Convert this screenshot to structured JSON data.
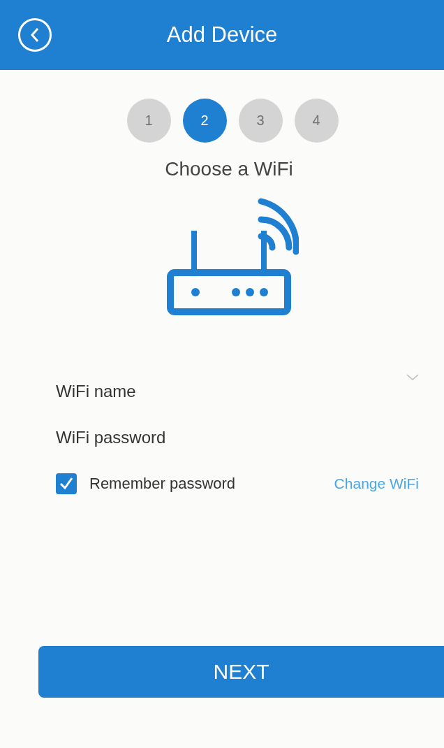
{
  "header": {
    "title": "Add Device"
  },
  "steps": [
    {
      "label": "1",
      "selected": false
    },
    {
      "label": "2",
      "selected": true
    },
    {
      "label": "3",
      "selected": false
    },
    {
      "label": "4",
      "selected": false
    }
  ],
  "heading": "Choose a WiFi",
  "fields": [
    {
      "label": "WiFi name",
      "kind": "select"
    },
    {
      "label": "WiFi password",
      "kind": "password"
    }
  ],
  "remember": {
    "label": "Remember password",
    "checked": true
  },
  "change_link": "Change WiFi",
  "next_button": "NEXT"
}
